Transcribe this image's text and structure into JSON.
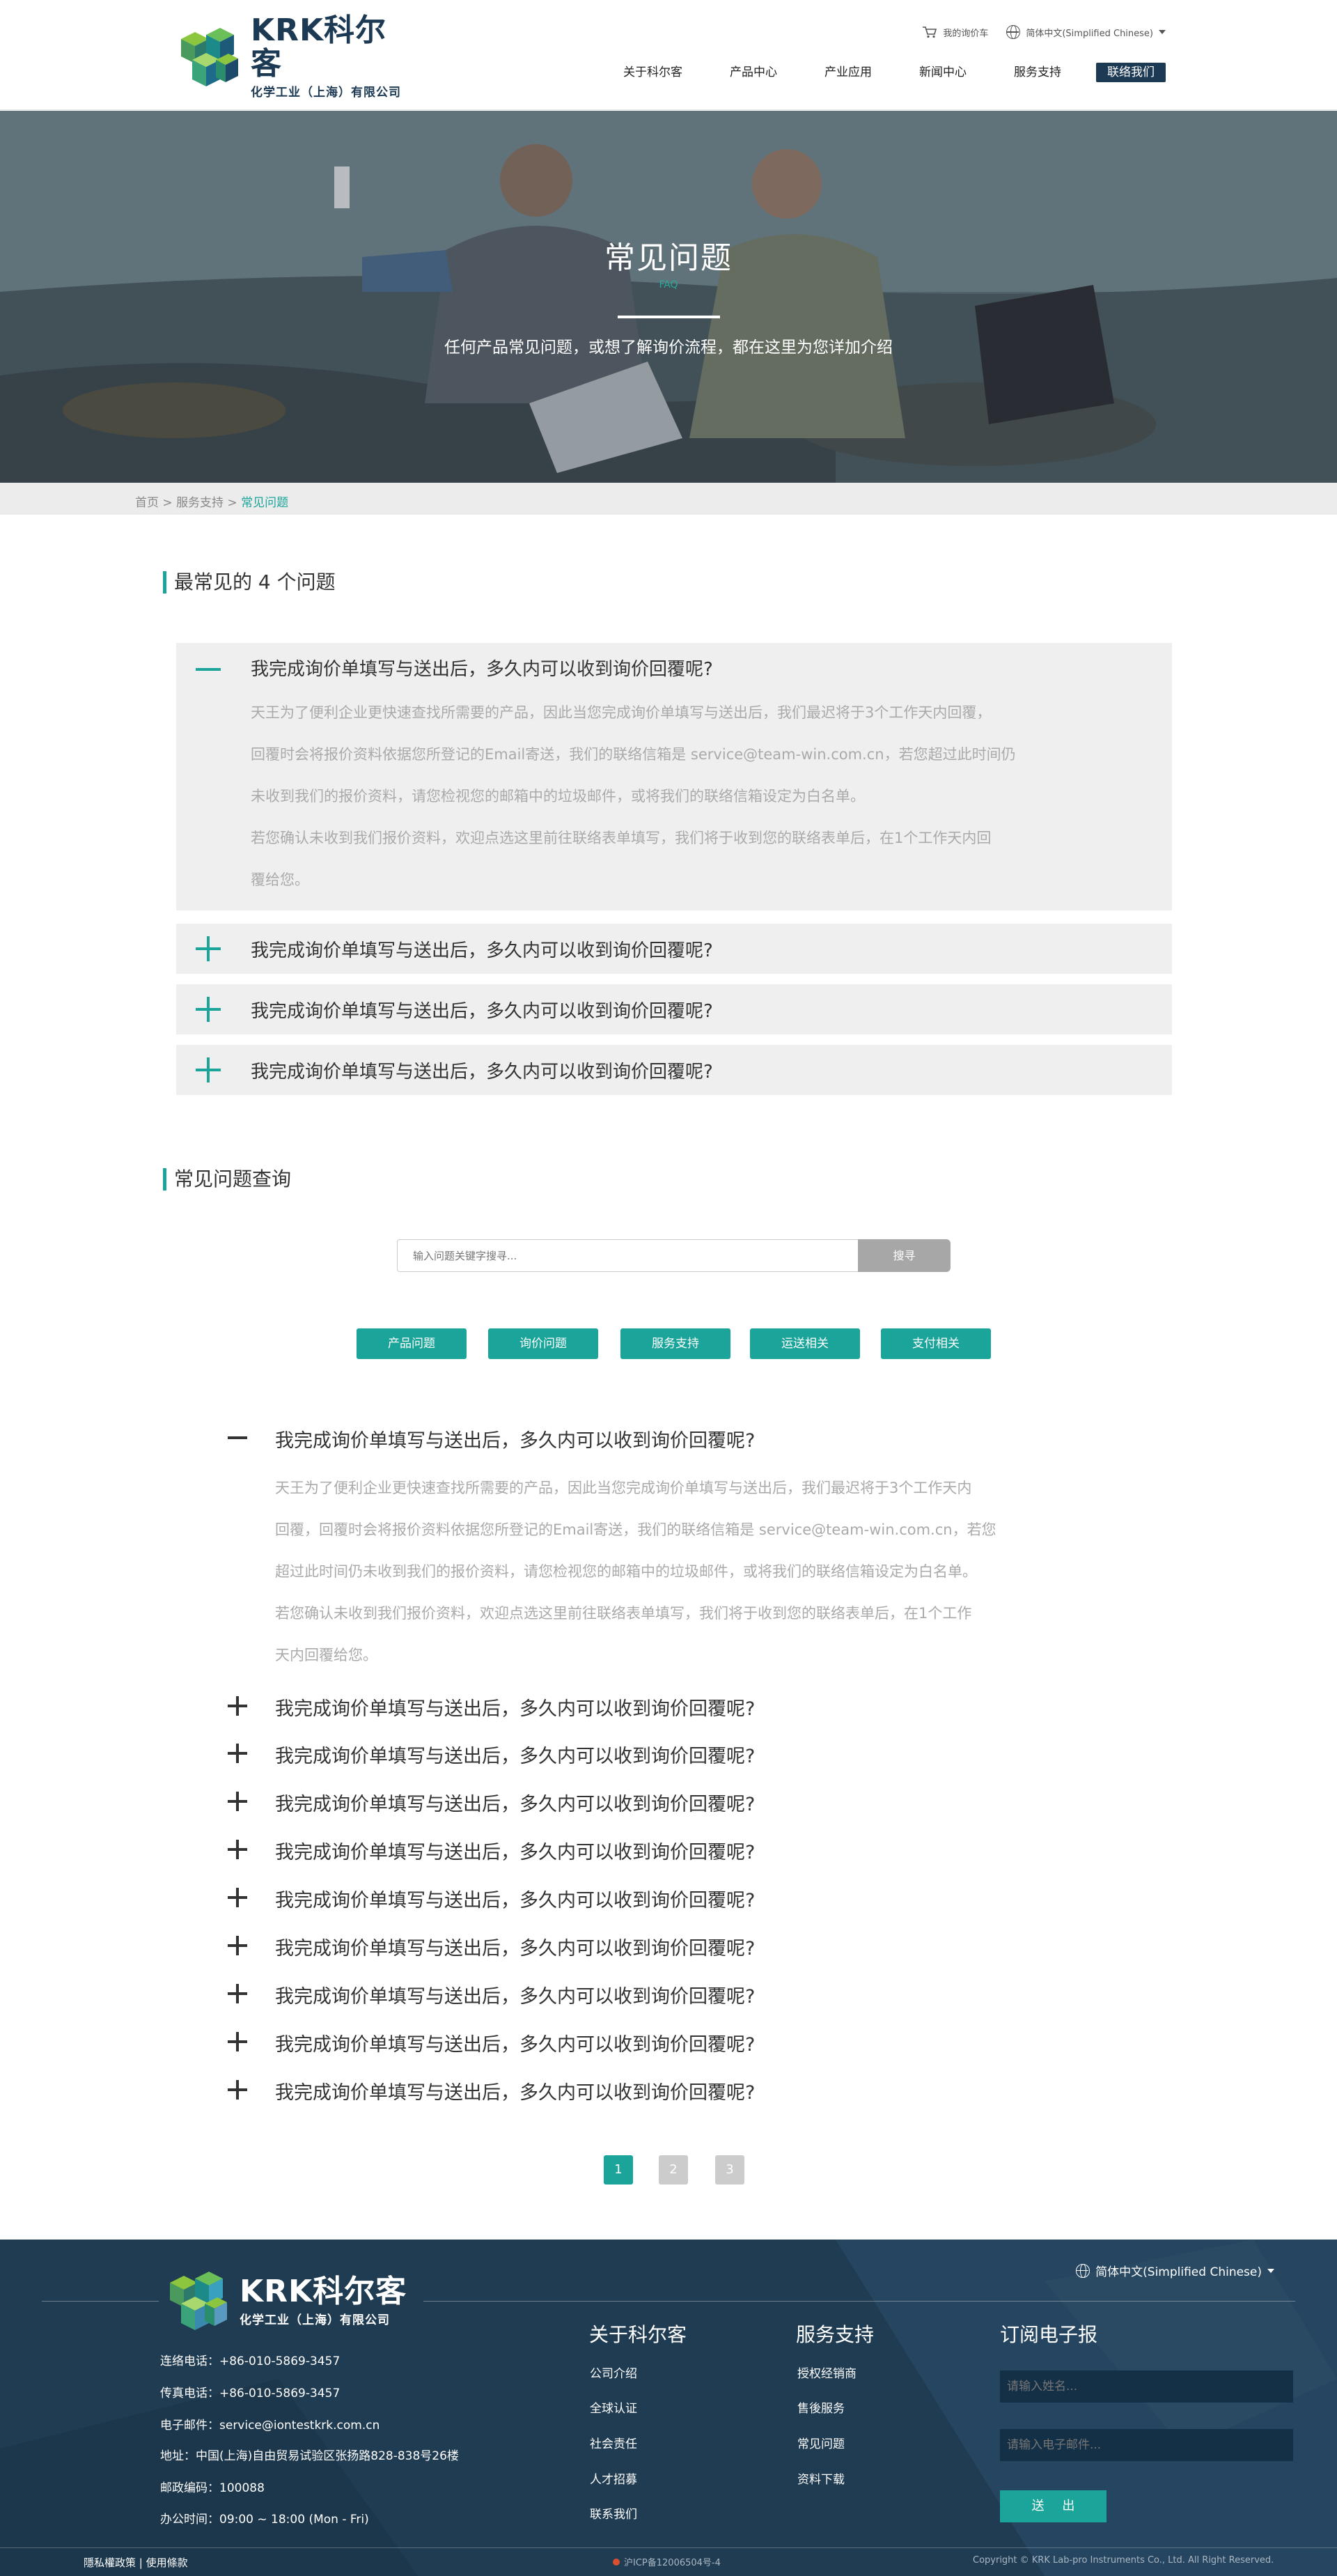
{
  "header": {
    "logo_brand": "KRK科尔客",
    "logo_sub": "化学工业（上海）有限公司",
    "util_cart": "我的询价车",
    "util_lang": "简体中文(Simplified Chinese)",
    "nav": [
      "关于科尔客",
      "产品中心",
      "产业应用",
      "新闻中心",
      "服务支持"
    ],
    "nav_contact": "联络我们"
  },
  "banner": {
    "title": "常见问题",
    "sub_small": "FAQ",
    "desc": "任何产品常见问题，或想了解询价流程，都在这里为您详加介绍"
  },
  "breadcrumb": {
    "home": "首页",
    "sep": ">",
    "parent": "服务支持",
    "current": "常见问题"
  },
  "top_faq": {
    "title": "最常见的 4 个问题",
    "items": [
      {
        "question": "我完成询价单填写与送出后，多久内可以收到询价回覆呢?",
        "expanded": true,
        "answer_lines": [
          "天王为了便利企业更快速查找所需要的产品，因此当您完成询价单填写与送出后，我们最迟将于3个工作天内回覆，",
          "回覆时会将报价资料依据您所登记的Email寄送，我们的联络信箱是 service@team-win.com.cn，若您超过此时间仍",
          "未收到我们的报价资料，请您检视您的邮箱中的垃圾邮件，或将我们的联络信箱设定为白名单。",
          "若您确认未收到我们报价资料，欢迎点选这里前往联络表单填写，我们将于收到您的联络表单后，在1个工作天内回",
          "覆给您。"
        ]
      },
      {
        "question": "我完成询价单填写与送出后，多久内可以收到询价回覆呢?",
        "expanded": false
      },
      {
        "question": "我完成询价单填写与送出后，多久内可以收到询价回覆呢?",
        "expanded": false
      },
      {
        "question": "我完成询价单填写与送出后，多久内可以收到询价回覆呢?",
        "expanded": false
      }
    ]
  },
  "query": {
    "title": "常见问题查询",
    "search_placeholder": "输入问题关键字搜寻...",
    "search_button": "搜寻",
    "categories": [
      "产品问题",
      "询价问题",
      "服务支持",
      "运送相关",
      "支付相关"
    ]
  },
  "faq_list": {
    "expanded": {
      "question": "我完成询价单填写与送出后，多久内可以收到询价回覆呢?",
      "answer_lines": [
        "天王为了便利企业更快速查找所需要的产品，因此当您完成询价单填写与送出后，我们最迟将于3个工作天内",
        "回覆，回覆时会将报价资料依据您所登记的Email寄送，我们的联络信箱是 service@team-win.com.cn，若您",
        "超过此时间仍未收到我们的报价资料，请您检视您的邮箱中的垃圾邮件，或将我们的联络信箱设定为白名单。",
        "若您确认未收到我们报价资料，欢迎点选这里前往联络表单填写，我们将于收到您的联络表单后，在1个工作",
        "天内回覆给您。"
      ]
    },
    "collapsed": [
      "我完成询价单填写与送出后，多久内可以收到询价回覆呢?",
      "我完成询价单填写与送出后，多久内可以收到询价回覆呢?",
      "我完成询价单填写与送出后，多久内可以收到询价回覆呢?",
      "我完成询价单填写与送出后，多久内可以收到询价回覆呢?",
      "我完成询价单填写与送出后，多久内可以收到询价回覆呢?",
      "我完成询价单填写与送出后，多久内可以收到询价回覆呢?",
      "我完成询价单填写与送出后，多久内可以收到询价回覆呢?",
      "我完成询价单填写与送出后，多久内可以收到询价回覆呢?",
      "我完成询价单填写与送出后，多久内可以收到询价回覆呢?"
    ]
  },
  "pagination": {
    "pages": [
      "1",
      "2",
      "3"
    ],
    "current": "1"
  },
  "footer": {
    "logo_brand": "KRK科尔客",
    "logo_sub": "化学工业（上海）有限公司",
    "lang": "简体中文(Simplified Chinese)",
    "info": [
      "连络电话：+86-010-5869-3457",
      "传真电话：+86-010-5869-3457",
      "电子邮件：service@iontestkrk.com.cn",
      "地址：中国(上海)自由贸易试验区张扬路828-838号26楼",
      "邮政编码：100088",
      "办公时间：09:00 ~ 18:00 (Mon - Fri)"
    ],
    "col_about_title": "关于科尔客",
    "col_about_links": [
      "公司介绍",
      "全球认证",
      "社会责任",
      "人才招募",
      "联系我们"
    ],
    "col_service_title": "服务支持",
    "col_service_links": [
      "授权经销商",
      "售後服务",
      "常见问题",
      "资料下载"
    ],
    "col_subscribe_title": "订阅电子报",
    "name_placeholder": "请输入姓名...",
    "email_placeholder": "请输入电子邮件...",
    "send_button": "送 出",
    "policy": "隱私權政策 | 使用條款",
    "icp": "沪ICP备12006504号-4",
    "copyright": "Copyright © KRK Lab-pro Instruments Co., Ltd. All Right Reserved."
  },
  "colors": {
    "accent": "#1ba49a",
    "navy": "#1d3a55",
    "footer_bg": "#203c52"
  }
}
